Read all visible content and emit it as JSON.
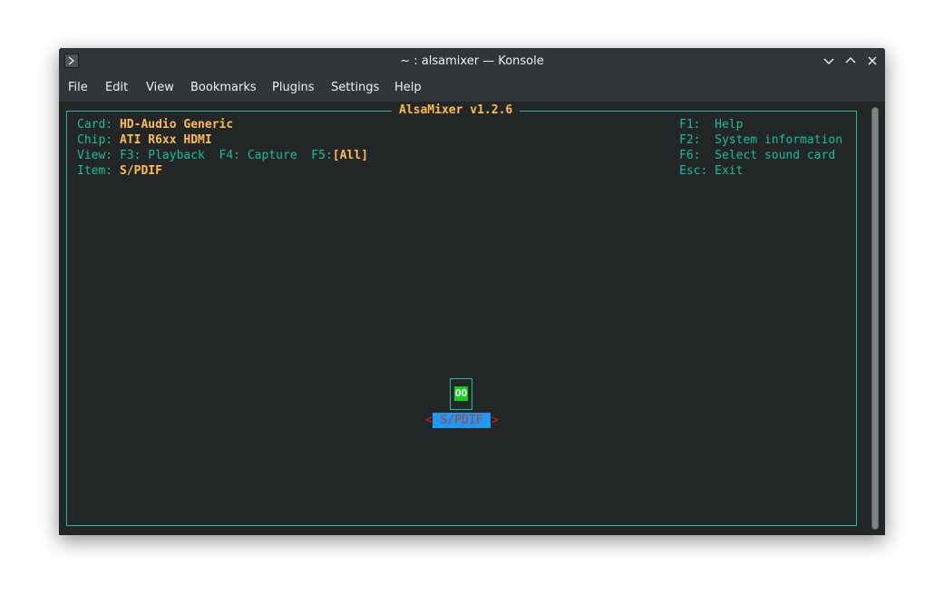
{
  "window": {
    "title": "~ : alsamixer — Konsole"
  },
  "menubar": {
    "items": [
      "File",
      "Edit",
      "View",
      "Bookmarks",
      "Plugins",
      "Settings",
      "Help"
    ]
  },
  "alsamixer": {
    "frame_title": "AlsaMixer v1.2.6",
    "card_label": "Card:",
    "card_value": "HD-Audio Generic",
    "chip_label": "Chip:",
    "chip_value": "ATI R6xx HDMI",
    "view_label": "View:",
    "view_playback": "F3: Playback",
    "view_capture": "F4: Capture",
    "view_all_key": "F5:",
    "view_all_value": "[All]",
    "item_label": "Item:",
    "item_value": "S/PDIF",
    "help": [
      {
        "key": "F1:",
        "text": "Help"
      },
      {
        "key": "F2:",
        "text": "System information"
      },
      {
        "key": "F6:",
        "text": "Select sound card"
      },
      {
        "key": "Esc:",
        "text": "Exit"
      }
    ],
    "control": {
      "state": "OO",
      "left_arrow": "<",
      "name": " S/PDIF ",
      "right_arrow": ">"
    }
  },
  "colors": {
    "accent_cyan": "#1abc9c",
    "value_yellow": "#fdbc4b",
    "switch_green": "#11d116",
    "selection_blue": "#1d99f3",
    "arrow_red": "#ed1515",
    "terminal_bg": "#232627"
  }
}
